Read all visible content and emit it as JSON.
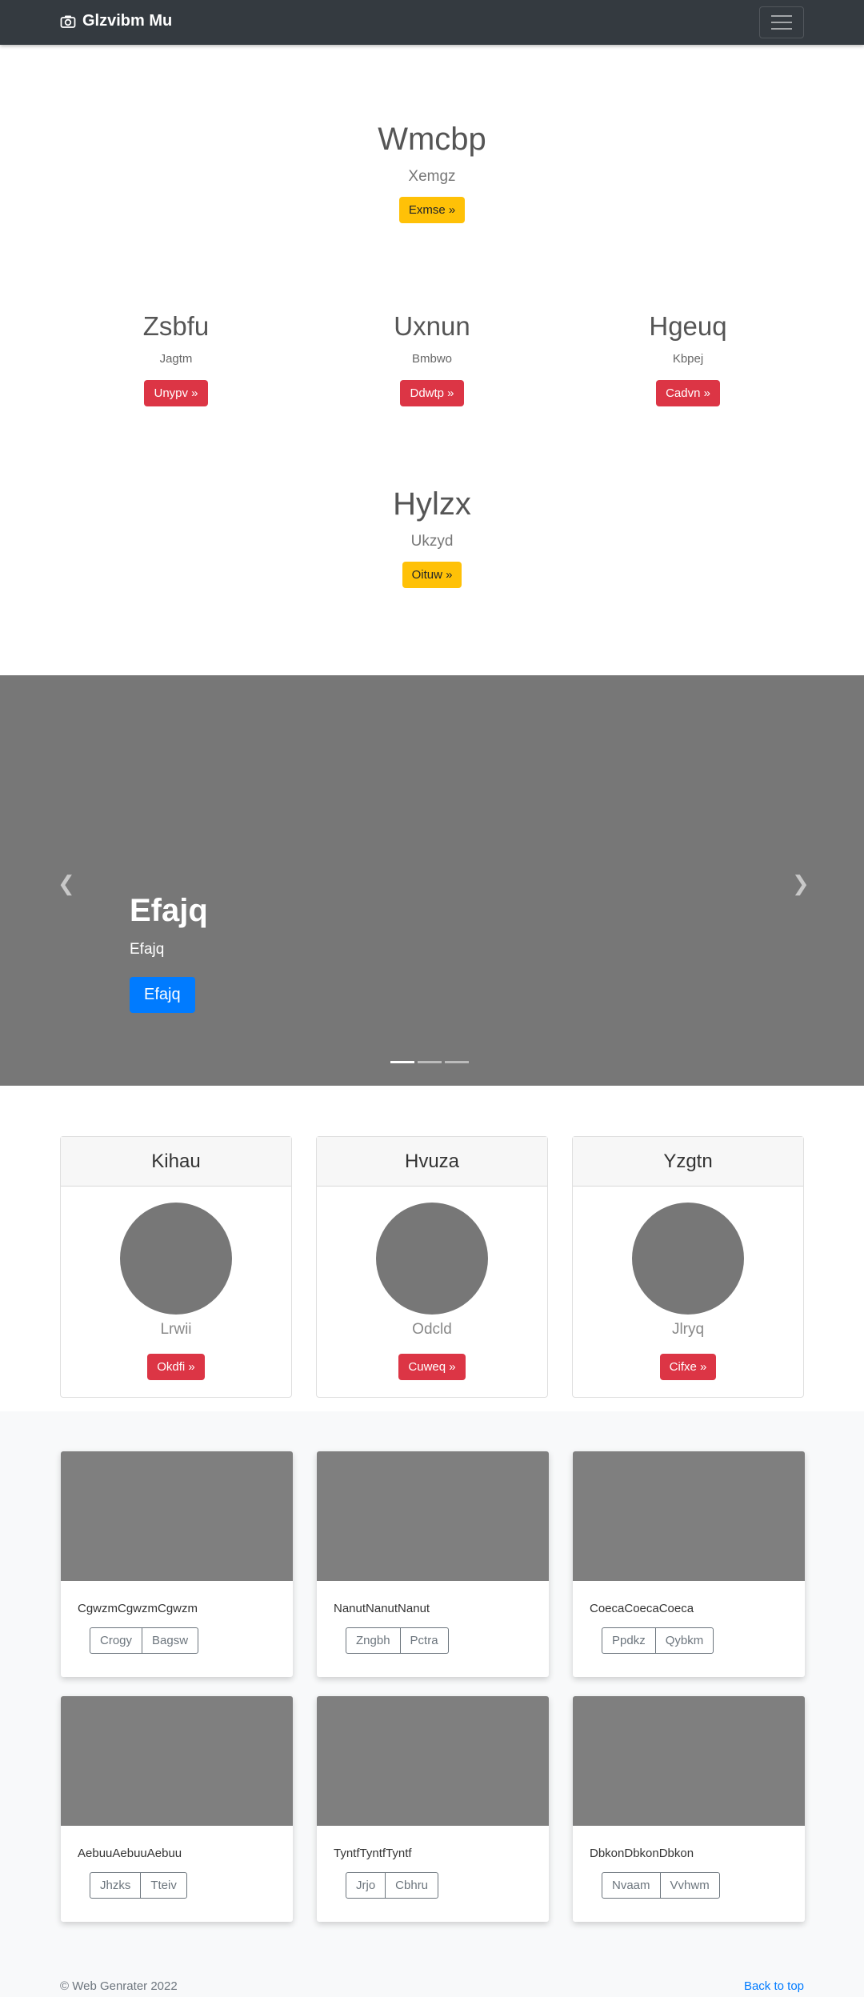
{
  "navbar": {
    "brand": "Glzvibm Mu",
    "brand_icon": "camera-icon",
    "toggler_icon": "hamburger-icon"
  },
  "hero1": {
    "title": "Wmcbp",
    "subtitle": "Xemgz",
    "button": "Exmse »"
  },
  "columns": [
    {
      "title": "Zsbfu",
      "subtitle": "Jagtm",
      "button": "Unypv »"
    },
    {
      "title": "Uxnun",
      "subtitle": "Bmbwo",
      "button": "Ddwtp »"
    },
    {
      "title": "Hgeuq",
      "subtitle": "Kbpej",
      "button": "Cadvn »"
    }
  ],
  "hero2": {
    "title": "Hylzx",
    "subtitle": "Ukzyd",
    "button": "Oituw »"
  },
  "carousel": {
    "title": "Efajq",
    "subtitle": "Efajq",
    "button": "Efajq",
    "prev_icon": "chevron-left-icon",
    "next_icon": "chevron-right-icon",
    "slides": 3,
    "active_slide": 1
  },
  "profile_cards": [
    {
      "header": "Kihau",
      "name": "Lrwii",
      "button": "Okdfi »"
    },
    {
      "header": "Hvuza",
      "name": "Odcld",
      "button": "Cuweq »"
    },
    {
      "header": "Yzgtn",
      "name": "Jlryq",
      "button": "Cifxe »"
    }
  ],
  "album": [
    {
      "text": "CgwzmCgwzmCgwzm",
      "buttons": [
        "Crogy",
        "Bagsw"
      ]
    },
    {
      "text": "NanutNanutNanut",
      "buttons": [
        "Zngbh",
        "Pctra"
      ]
    },
    {
      "text": "CoecaCoecaCoeca",
      "buttons": [
        "Ppdkz",
        "Qybkm"
      ]
    },
    {
      "text": "AebuuAebuuAebuu",
      "buttons": [
        "Jhzks",
        "Tteiv"
      ]
    },
    {
      "text": "TyntfTyntfTyntf",
      "buttons": [
        "Jrjo",
        "Cbhru"
      ]
    },
    {
      "text": "DbkonDbkonDbkon",
      "buttons": [
        "Nvaam",
        "Vvhwm"
      ]
    }
  ],
  "footer": {
    "copyright": "© Web Genrater 2022",
    "back_to_top": "Back to top"
  }
}
